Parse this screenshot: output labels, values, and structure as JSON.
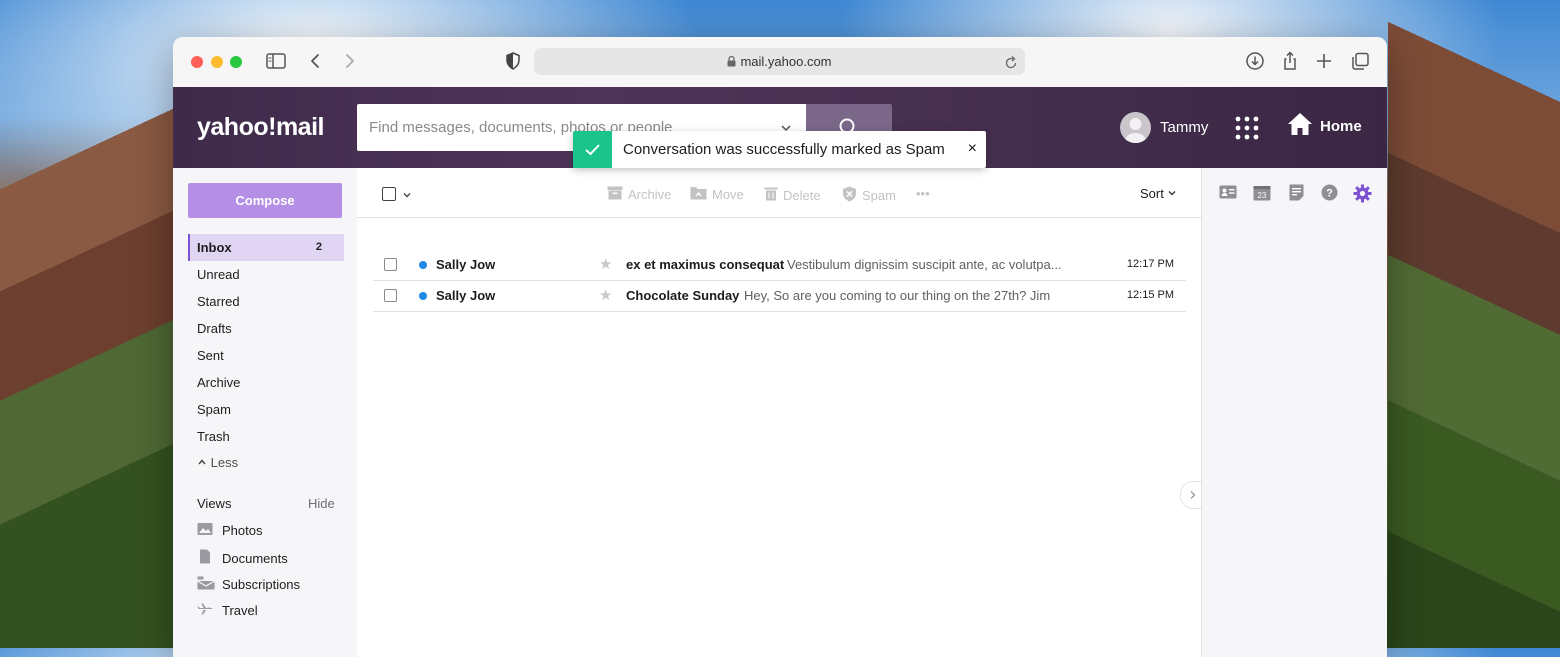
{
  "browser": {
    "url": "mail.yahoo.com"
  },
  "header": {
    "logo": "yahoo!mail",
    "search_placeholder": "Find messages, documents, photos or people",
    "user_name": "Tammy",
    "home_label": "Home"
  },
  "toast": {
    "message": "Conversation was successfully marked as Spam",
    "close": "×"
  },
  "sidebar": {
    "compose_label": "Compose",
    "folders": [
      {
        "label": "Inbox",
        "count": "2"
      },
      {
        "label": "Unread"
      },
      {
        "label": "Starred"
      },
      {
        "label": "Drafts"
      },
      {
        "label": "Sent"
      },
      {
        "label": "Archive"
      },
      {
        "label": "Spam"
      },
      {
        "label": "Trash"
      }
    ],
    "less_label": "Less",
    "views_label": "Views",
    "hide_label": "Hide",
    "views": [
      {
        "label": "Photos",
        "icon": "photos-icon"
      },
      {
        "label": "Documents",
        "icon": "documents-icon"
      },
      {
        "label": "Subscriptions",
        "icon": "subscriptions-icon"
      },
      {
        "label": "Travel",
        "icon": "travel-icon"
      }
    ]
  },
  "toolbar": {
    "archive": "Archive",
    "move": "Move",
    "delete": "Delete",
    "spam": "Spam",
    "more": "•••",
    "sort": "Sort"
  },
  "messages": [
    {
      "from": "Sally Jow",
      "subject": "ex et maximus consequat",
      "preview": "Vestibulum dignissim suscipit ante, ac volutpa...",
      "time": "12:17 PM",
      "unread": true
    },
    {
      "from": "Sally Jow",
      "subject": "Chocolate Sunday",
      "preview": "Hey, So are you coming to our thing on the 27th? Jim",
      "time": "12:15 PM",
      "unread": true
    }
  ],
  "rail": {
    "calendar_day": "23"
  },
  "colors": {
    "header_bg": "#4e3558",
    "compose": "#b58fe5",
    "accent": "#7d52d3",
    "toast_ok": "#1ac48a",
    "unread_dot": "#1e88e5"
  }
}
